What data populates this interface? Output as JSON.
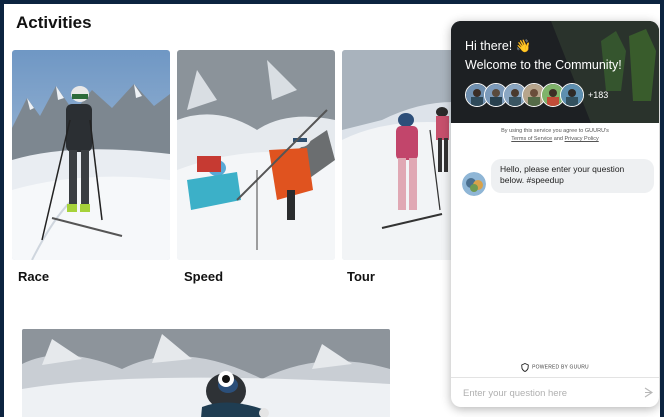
{
  "page": {
    "title": "Activities",
    "activities": [
      {
        "label": "Race"
      },
      {
        "label": "Speed"
      },
      {
        "label": "Tour"
      }
    ]
  },
  "chat": {
    "greeting": "Hi there! 👋",
    "welcome": "Welcome to the Community!",
    "member_count": "+183",
    "terms_prefix": "By using this service you agree to GUURU's",
    "terms_link": "Terms of Service",
    "terms_and": "and",
    "privacy_link": "Privacy Policy",
    "message": "Hello, please enter your question below. #speedup",
    "powered_by": "POWERED BY GUURU",
    "input_placeholder": "Enter your question here"
  },
  "icons": {
    "send": "send-arrow-icon",
    "guuru_logo": "shield-logo-icon"
  },
  "colors": {
    "frame_background": "#0c2440",
    "chat_header": "#1f2326",
    "bubble": "#eef0f2"
  }
}
